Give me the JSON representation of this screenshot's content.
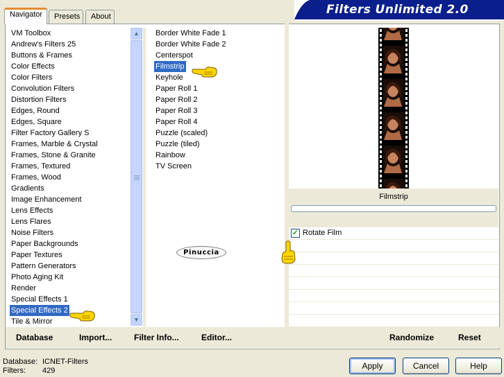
{
  "app": {
    "title": "Filters Unlimited 2.0"
  },
  "tabs": [
    {
      "label": "Navigator",
      "active": true
    },
    {
      "label": "Presets",
      "active": false
    },
    {
      "label": "About",
      "active": false
    }
  ],
  "categories": {
    "items": [
      "VM Toolbox",
      "Andrew's Filters 25",
      "Buttons & Frames",
      "Color Effects",
      "Color Filters",
      "Convolution Filters",
      "Distortion Filters",
      "Edges, Round",
      "Edges, Square",
      "Filter Factory Gallery S",
      "Frames, Marble & Crystal",
      "Frames, Stone & Granite",
      "Frames, Textured",
      "Frames, Wood",
      "Gradients",
      "Image Enhancement",
      "Lens Effects",
      "Lens Flares",
      "Noise Filters",
      "Paper Backgrounds",
      "Paper Textures",
      "Pattern Generators",
      "Photo Aging Kit",
      "Render",
      "Special Effects 1",
      "Special Effects 2",
      "Tile & Mirror"
    ],
    "selected": "Special Effects 2"
  },
  "filters": {
    "items": [
      "Border White Fade 1",
      "Border White Fade 2",
      "Centerspot",
      "Filmstrip",
      "Keyhole",
      "Paper Roll 1",
      "Paper Roll 2",
      "Paper Roll 3",
      "Paper Roll 4",
      "Puzzle (scaled)",
      "Puzzle (tiled)",
      "Rainbow",
      "TV Screen"
    ],
    "selected": "Filmstrip"
  },
  "preview": {
    "caption": "Filmstrip",
    "slider_value": 0
  },
  "parameters": [
    {
      "label": "Rotate Film",
      "checked": true
    }
  ],
  "watermark": "Pinuccia",
  "toolbar": {
    "database_label": "Database",
    "import_label": "Import...",
    "filter_info_label": "Filter Info...",
    "editor_label": "Editor...",
    "randomize_label": "Randomize",
    "reset_label": "Reset"
  },
  "status": {
    "database_key": "Database:",
    "database_value": "ICNET-Filters",
    "filters_key": "Filters:",
    "filters_value": "429"
  },
  "buttons": {
    "apply": "Apply",
    "cancel": "Cancel",
    "help": "Help"
  },
  "colors": {
    "selection": "#316ac5",
    "banner": "#0a1e8c",
    "window_bg": "#ece9d8"
  }
}
